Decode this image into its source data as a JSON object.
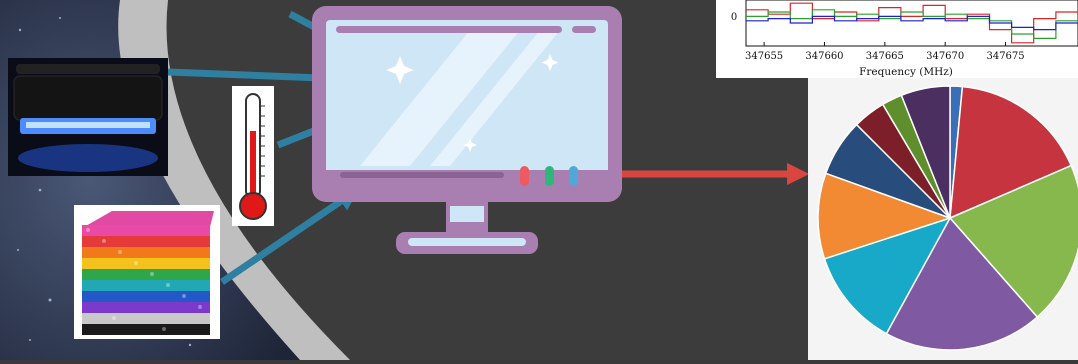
{
  "scene": {
    "colors": {
      "background": "#3a3a3a",
      "arrow_in": "#2e7fa0",
      "arrow_out": "#d9453f",
      "monitor_frame": "#a87fb0",
      "monitor_screen": "#cfe6f7"
    }
  },
  "inputs": [
    {
      "icon": "uv-lamp-icon"
    },
    {
      "icon": "thermometer-icon"
    },
    {
      "icon": "magnetic-balls-cube-icon"
    }
  ],
  "monitor": {
    "icon": "computer-monitor-icon",
    "indicator_colors": [
      "#ee5a61",
      "#2db77a",
      "#4fa8d8"
    ]
  },
  "spectrum": {
    "x_ticks": [
      "347655",
      "347660",
      "347665",
      "347670",
      "347675"
    ],
    "y_tick": "0",
    "xlabel": "Frequency  (MHz)"
  },
  "chart_data": [
    {
      "type": "line",
      "xlabel": "Frequency  (MHz)",
      "ylabel": "",
      "x_ticks": [
        347655,
        347660,
        347665,
        347670,
        347675
      ],
      "xlim": [
        347653.5,
        347681
      ],
      "series": [
        {
          "color": "#d62728",
          "values": [
            0.6,
            0.4,
            0.9,
            0.2,
            0.5,
            0.1,
            0.7,
            0.3,
            0.8,
            0.2,
            0.4,
            -0.3,
            -0.9,
            0.2,
            0.5
          ]
        },
        {
          "color": "#2ca02c",
          "values": [
            0.3,
            0.5,
            0.2,
            0.6,
            0.3,
            0.4,
            0.2,
            0.5,
            0.3,
            0.4,
            0.2,
            0.1,
            -0.5,
            -0.7,
            0.1
          ]
        },
        {
          "color": "#1f1fd6",
          "values": [
            0.1,
            0.2,
            0.0,
            0.3,
            0.1,
            0.2,
            0.3,
            0.1,
            0.2,
            0.1,
            0.3,
            0.0,
            -0.2,
            -0.3,
            0.0
          ]
        }
      ]
    },
    {
      "type": "pie",
      "slices": [
        {
          "value": 1.5,
          "color": "#3a6fb8"
        },
        {
          "value": 17,
          "color": "#c6343f"
        },
        {
          "value": 20,
          "color": "#86b84d"
        },
        {
          "value": 19.5,
          "color": "#8059a3"
        },
        {
          "value": 12,
          "color": "#18a9c9"
        },
        {
          "value": 10.5,
          "color": "#f18a32"
        },
        {
          "value": 7,
          "color": "#284d7c"
        },
        {
          "value": 4,
          "color": "#7c1f29"
        },
        {
          "value": 2.5,
          "color": "#5e8f2c"
        },
        {
          "value": 6,
          "color": "#4a2f60"
        }
      ]
    }
  ]
}
